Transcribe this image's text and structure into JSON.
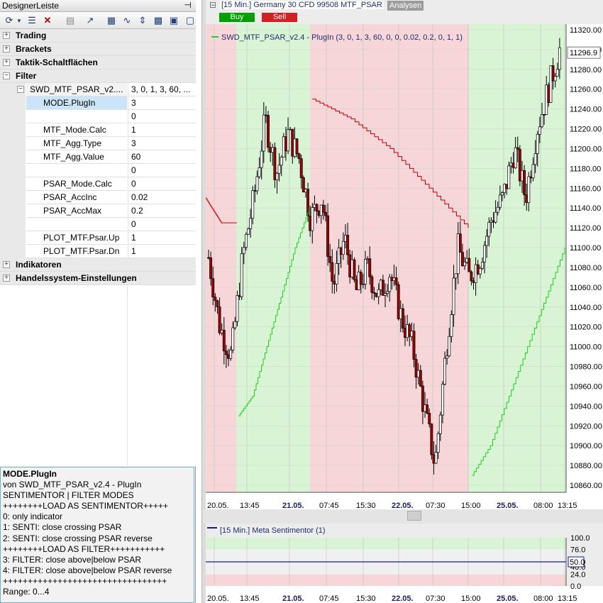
{
  "panel": {
    "title": "DesignerLeiste",
    "pin": "⊣"
  },
  "toolbar": {
    "icons": [
      "refresh-icon",
      "dropdown-arrow-icon",
      "list-icon",
      "delete-icon",
      "document-icon",
      "chart-line-icon",
      "print-icon",
      "trend-icon",
      "arrows-icon",
      "grid-icon",
      "table-icon",
      "window-icon"
    ]
  },
  "tree": {
    "groups_top": [
      "Trading",
      "Brackets",
      "Taktik-Schaltflächen",
      "Filter"
    ],
    "plugin": {
      "name": "SWD_MTF_PSAR_v2....",
      "value": "3, 0, 1, 3, 60, ..."
    },
    "params": [
      {
        "name": "MODE.PlugIn",
        "value": "3"
      },
      {
        "name": "",
        "value": "0"
      },
      {
        "name": "MTF_Mode.Calc",
        "value": "1"
      },
      {
        "name": "MTF_Agg.Type",
        "value": "3"
      },
      {
        "name": "MTF_Agg.Value",
        "value": "60"
      },
      {
        "name": "",
        "value": "0"
      },
      {
        "name": "PSAR_Mode.Calc",
        "value": "0"
      },
      {
        "name": "PSAR_AccInc",
        "value": "0.02"
      },
      {
        "name": "PSAR_AccMax",
        "value": "0.2"
      },
      {
        "name": "",
        "value": "0"
      },
      {
        "name": "PLOT_MTF.Psar.Up",
        "value": "1"
      },
      {
        "name": "PLOT_MTF.Psar.Dn",
        "value": "1"
      }
    ],
    "groups_bottom": [
      "Indikatoren",
      "Handelssystem-Einstellungen"
    ]
  },
  "description": {
    "title": "MODE.PlugIn",
    "lines": [
      "von SWD_MTF_PSAR_v2.4 - PlugIn",
      "SENTIMENTOR | FILTER MODES",
      "++++++++LOAD AS SENTIMENTOR+++++",
      "0: only indicator",
      "1: SENTI: close crossing PSAR",
      "2: SENTI: close crossing PSAR reverse",
      "++++++++LOAD AS FILTER+++++++++++",
      "3: FILTER: close above|below PSAR",
      "4: FILTER: close above|below PSAR reverse",
      "+++++++++++++++++++++++++++++++++",
      "Range: 0...4"
    ]
  },
  "chart": {
    "header": "[15 Min.] Germany 30 CFD   99508 MTF_PSAR",
    "tab": "Analysen",
    "buy": "Buy",
    "sell": "Sell",
    "legend": "SWD_MTF_PSAR_v2.4 - PlugIn  (3, 0, 1, 3, 60, 0, 0, 0.02, 0.2, 0, 1, 1)",
    "last_price": "11296.9",
    "y_ticks": [
      "11320.00",
      "11300.00",
      "11280.00",
      "11260.00",
      "11240.00",
      "11220.00",
      "11200.00",
      "11180.00",
      "11160.00",
      "11140.00",
      "11120.00",
      "11100.00",
      "11080.00",
      "11060.00",
      "11040.00",
      "11020.00",
      "11000.00",
      "10980.00",
      "10960.00",
      "10940.00",
      "10920.00",
      "10900.00",
      "10880.00",
      "10860.00"
    ],
    "x_ticks": [
      {
        "label": "20.05.",
        "bold": false
      },
      {
        "label": "13:45",
        "bold": false
      },
      {
        "label": "21.05.",
        "bold": true
      },
      {
        "label": "07:45",
        "bold": false
      },
      {
        "label": "15:30",
        "bold": false
      },
      {
        "label": "22.05.",
        "bold": true
      },
      {
        "label": "07:30",
        "bold": false
      },
      {
        "label": "15:00",
        "bold": false
      },
      {
        "label": "25.05.",
        "bold": true
      },
      {
        "label": "08:00",
        "bold": false
      },
      {
        "label": "13:15",
        "bold": false
      }
    ],
    "colors": {
      "bull_zone": "#d8f4d4",
      "bear_zone": "#f6d6d8",
      "psar_up": "#1fd11f",
      "psar_down": "#cc0000",
      "candle_up": "#ffffff",
      "candle_down": "#a00000"
    }
  },
  "sub": {
    "header": "[15 Min.] Meta Sentimentor  (1)",
    "y_ticks": [
      "100.0",
      "76.0",
      "50.0",
      "40.0",
      "24.0",
      "0.0"
    ],
    "value": "50.0"
  },
  "chart_data": {
    "type": "candlestick",
    "title": "[15 Min.] Germany 30 CFD   99508 MTF_PSAR",
    "ylim": [
      10860,
      11320
    ],
    "x_labels": [
      "20.05.",
      "13:45",
      "21.05.",
      "07:45",
      "15:30",
      "22.05.",
      "07:30",
      "15:00",
      "25.05.",
      "08:00",
      "13:15"
    ],
    "close_path": [
      11090,
      11020,
      10990,
      11090,
      11150,
      11230,
      11175,
      11215,
      11190,
      11130,
      11150,
      11060,
      11110,
      11055,
      11080,
      11050,
      11075,
      11030,
      11000,
      10940,
      10880,
      11000,
      11100,
      11070,
      11090,
      11130,
      11150,
      11200,
      11150,
      11220,
      11260,
      11300
    ],
    "psar_down_path": [
      [
        11150,
        11125,
        11125
      ],
      [
        11250,
        11230,
        11200,
        11160,
        11120
      ]
    ],
    "psar_up_path": [
      [
        10930,
        10950,
        11000,
        11050,
        11100,
        11140
      ],
      [
        10870,
        10900,
        10950,
        11000,
        11050,
        11100
      ]
    ],
    "sentimentor": {
      "ylim": [
        0,
        100
      ],
      "value": 50,
      "levels": [
        100,
        76,
        50,
        40,
        24,
        0
      ]
    }
  }
}
